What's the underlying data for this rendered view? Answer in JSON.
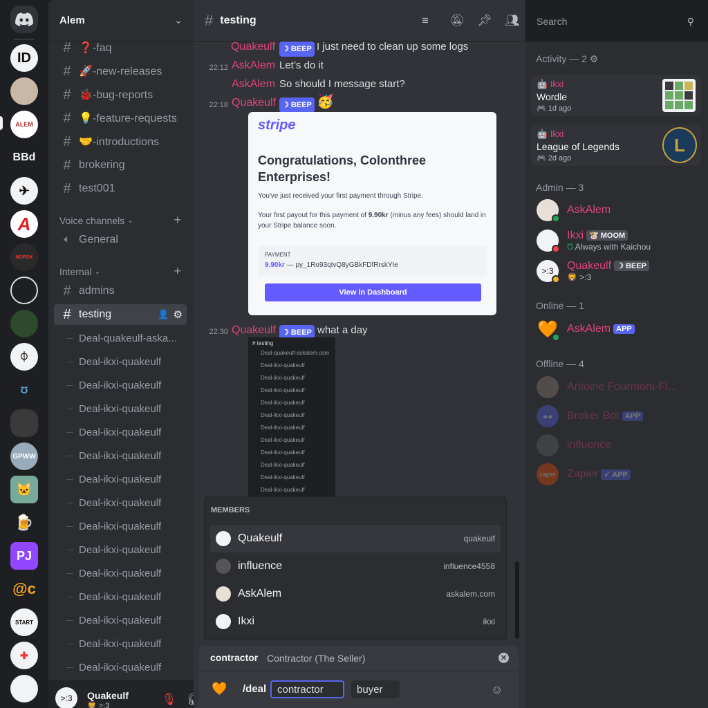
{
  "guild": {
    "name": "Alem"
  },
  "rail": {
    "servers": [
      "BBd",
      "GPWW",
      "PJ",
      "@c"
    ]
  },
  "channels": [
    {
      "name": "❓-faq"
    },
    {
      "name": "🚀-new-releases"
    },
    {
      "name": "🐞-bug-reports"
    },
    {
      "name": "💡-feature-requests"
    },
    {
      "name": "🤝-introductions"
    },
    {
      "name": "brokering"
    },
    {
      "name": "test001"
    }
  ],
  "voice": {
    "category": "Voice channels",
    "channel": "General"
  },
  "internal": {
    "category": "Internal",
    "admins": "admins",
    "testing": "testing"
  },
  "threads": [
    "Deal-quakeulf-aska...",
    "Deal-ikxi-quakeulf",
    "Deal-ikxi-quakeulf",
    "Deal-ikxi-quakeulf",
    "Deal-ikxi-quakeulf",
    "Deal-ikxi-quakeulf",
    "Deal-ikxi-quakeulf",
    "Deal-ikxi-quakeulf",
    "Deal-ikxi-quakeulf",
    "Deal-ikxi-quakeulf",
    "Deal-ikxi-quakeulf",
    "Deal-ikxi-quakeulf",
    "Deal-ikxi-quakeulf",
    "Deal-ikxi-quakeulf",
    "Deal-ikxi-quakeulf"
  ],
  "user": {
    "name": "Quakeulf",
    "status": "🦁 >:3"
  },
  "header": {
    "channel": "testing",
    "search_placeholder": "Search"
  },
  "messages": {
    "m1": {
      "author": "Quakeulf",
      "badge": "BEEP",
      "text": "I just need to clean up some logs"
    },
    "m2": {
      "time": "22:12",
      "author": "AskAlem",
      "text": "Let’s do it"
    },
    "m3": {
      "author": "AskAlem",
      "text": "So should I message start?"
    },
    "m4": {
      "time": "22:18",
      "author": "Quakeulf",
      "badge": "BEEP"
    },
    "m5": {
      "time": "22:30",
      "author": "Quakeulf",
      "badge": "BEEP",
      "text": "what a day"
    }
  },
  "stripe": {
    "logo": "stripe",
    "title": "Congratulations, Colonthree Enterprises!",
    "p1": "You've just received your first payment through Stripe.",
    "p2a": "Your first payout for this payment of ",
    "p2b": "9.90kr",
    "p2c": " (minus any fees) should land in your Stripe balance soon.",
    "payment_label": "PAYMENT",
    "amount": "9.90kr",
    "ref": " — py_1Ro93qIvQ8yGBkFDfRrskYIe",
    "button": "View in Dashboard"
  },
  "screenshot": {
    "channel": "testing",
    "items": [
      "Deal-quakeulf-askalem.com",
      "Deal-ikxi-quakeulf",
      "Deal-ikxi-quakeulf",
      "Deal-ikxi-quakeulf",
      "Deal-ikxi-quakeulf",
      "Deal-ikxi-quakeulf",
      "Deal-ikxi-quakeulf",
      "Deal-ikxi-quakeulf",
      "Deal-ikxi-quakeulf",
      "Deal-ikxi-quakeulf",
      "Deal-ikxi-quakeulf",
      "Deal-ikxi-quakeulf"
    ]
  },
  "autocomplete": {
    "title": "MEMBERS",
    "rows": [
      {
        "name": "Quakeulf",
        "user": "quakeulf"
      },
      {
        "name": "influence",
        "user": "influence4558"
      },
      {
        "name": "AskAlem",
        "user": "askalem.com"
      },
      {
        "name": "Ikxi",
        "user": "ikxi"
      }
    ]
  },
  "command": {
    "option_name": "contractor",
    "option_desc": "Contractor (The Seller)",
    "name": "/deal",
    "arg1": "contractor",
    "arg2": "buyer"
  },
  "members": {
    "activity_title": "Activity — 2",
    "activities": [
      {
        "user": "Ikxi",
        "game": "Wordle",
        "time": "1d ago"
      },
      {
        "user": "Ikxi",
        "game": "League of Legends",
        "time": "2d ago"
      }
    ],
    "admin_title": "Admin — 3",
    "admins": [
      {
        "name": "AskAlem"
      },
      {
        "name": "Ikxi",
        "badge": "MOOM",
        "status": "Always with Kaichou"
      },
      {
        "name": "Quakeulf",
        "badge": "BEEP",
        "status": ">:3"
      }
    ],
    "online_title": "Online — 1",
    "online": [
      {
        "name": "AskAlem",
        "badge": "APP"
      }
    ],
    "offline_title": "Offline — 4",
    "offline": [
      {
        "name": "Antoine Fourmont-Fi..."
      },
      {
        "name": "Broker Bot",
        "badge": "APP"
      },
      {
        "name": "influence"
      },
      {
        "name": "Zapier",
        "badge": "✓ APP",
        "avatar_text": "zapier"
      }
    ]
  },
  "colors": {
    "accent": "#5865f2",
    "author": "#e0457b",
    "online": "#23a55a",
    "dnd": "#f23f43"
  }
}
